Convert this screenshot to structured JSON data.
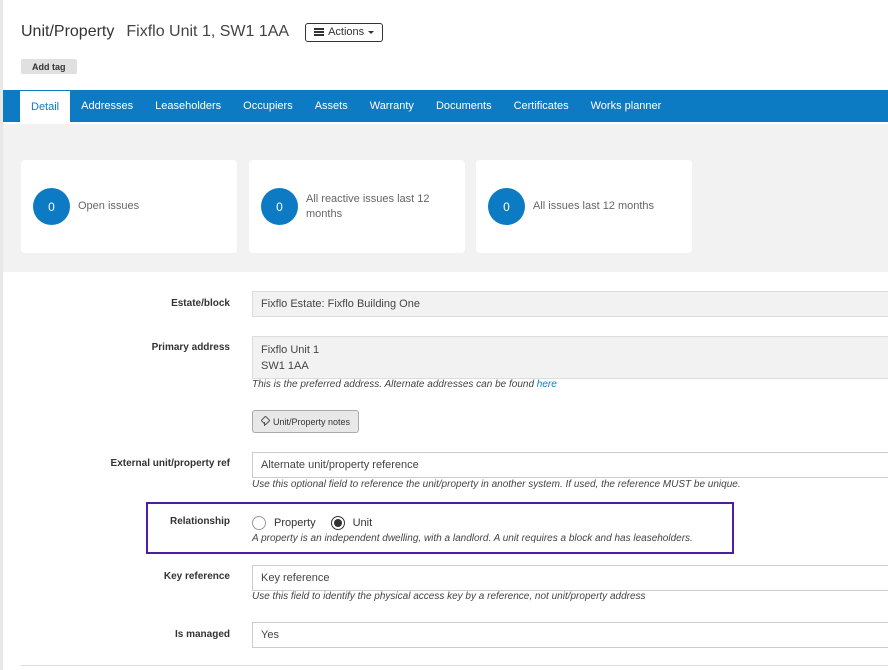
{
  "header": {
    "entity_type": "Unit/Property",
    "entity_name": "Fixflo Unit 1, SW1 1AA",
    "actions_label": "Actions",
    "add_tag_label": "Add tag"
  },
  "nav": {
    "tabs": [
      {
        "label": "Detail",
        "active": true
      },
      {
        "label": "Addresses"
      },
      {
        "label": "Leaseholders"
      },
      {
        "label": "Occupiers"
      },
      {
        "label": "Assets"
      },
      {
        "label": "Warranty"
      },
      {
        "label": "Documents"
      },
      {
        "label": "Certificates"
      },
      {
        "label": "Works planner"
      }
    ]
  },
  "stats": [
    {
      "value": "0",
      "label": "Open issues"
    },
    {
      "value": "0",
      "label": "All reactive issues last 12 months"
    },
    {
      "value": "0",
      "label": "All issues last 12 months"
    }
  ],
  "form": {
    "estate_block": {
      "label": "Estate/block",
      "value": "Fixflo Estate: Fixflo Building One"
    },
    "primary_address": {
      "label": "Primary address",
      "line1": "Fixflo Unit 1",
      "line2": "SW1 1AA",
      "help_prefix": "This is the preferred address. Alternate addresses can be found ",
      "help_link": "here"
    },
    "notes_button": "Unit/Property notes",
    "external_ref": {
      "label": "External unit/property ref",
      "placeholder": "Alternate unit/property reference",
      "help": "Use this optional field to reference the unit/property in another system. If used, the reference MUST be unique."
    },
    "relationship": {
      "label": "Relationship",
      "options": [
        {
          "label": "Property",
          "checked": false
        },
        {
          "label": "Unit",
          "checked": true
        }
      ],
      "help": "A property is an independent dwelling, with a landlord. A unit requires a block and has leaseholders."
    },
    "key_reference": {
      "label": "Key reference",
      "placeholder": "Key reference",
      "help": "Use this field to identify the physical access key by a reference, not unit/property address"
    },
    "is_managed": {
      "label": "Is managed",
      "value": "Yes"
    }
  },
  "colors": {
    "brand": "#0d7bc4",
    "highlight": "#4b1fa1"
  }
}
